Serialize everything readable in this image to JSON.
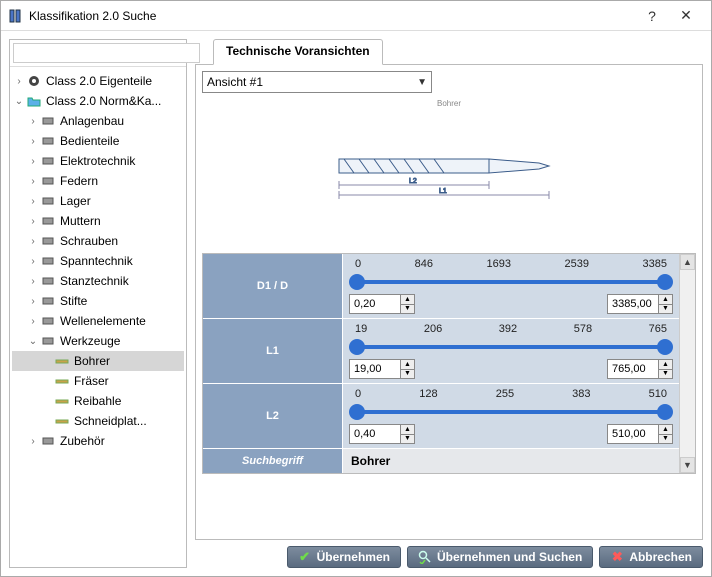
{
  "window": {
    "title": "Klassifikation 2.0 Suche",
    "help": "?",
    "close": "✕"
  },
  "sidebar": {
    "search_placeholder": "",
    "nodes": [
      {
        "level": 1,
        "caret": "right",
        "icon": "gear",
        "label": "Class 2.0 Eigenteile"
      },
      {
        "level": 1,
        "caret": "down",
        "icon": "folder",
        "label": "Class 2.0 Norm&Ka..."
      },
      {
        "level": 2,
        "caret": "right",
        "icon": "part",
        "label": "Anlagenbau"
      },
      {
        "level": 2,
        "caret": "right",
        "icon": "part",
        "label": "Bedienteile"
      },
      {
        "level": 2,
        "caret": "right",
        "icon": "part",
        "label": "Elektrotechnik"
      },
      {
        "level": 2,
        "caret": "right",
        "icon": "part",
        "label": "Federn"
      },
      {
        "level": 2,
        "caret": "right",
        "icon": "part",
        "label": "Lager"
      },
      {
        "level": 2,
        "caret": "right",
        "icon": "part",
        "label": "Muttern"
      },
      {
        "level": 2,
        "caret": "right",
        "icon": "part",
        "label": "Schrauben"
      },
      {
        "level": 2,
        "caret": "right",
        "icon": "part",
        "label": "Spanntechnik"
      },
      {
        "level": 2,
        "caret": "right",
        "icon": "part",
        "label": "Stanztechnik"
      },
      {
        "level": 2,
        "caret": "right",
        "icon": "part",
        "label": "Stifte"
      },
      {
        "level": 2,
        "caret": "right",
        "icon": "part",
        "label": "Wellenelemente"
      },
      {
        "level": 2,
        "caret": "down",
        "icon": "part",
        "label": "Werkzeuge"
      },
      {
        "level": 3,
        "caret": "none",
        "icon": "tool",
        "label": "Bohrer",
        "selected": true
      },
      {
        "level": 3,
        "caret": "none",
        "icon": "tool",
        "label": "Fräser"
      },
      {
        "level": 3,
        "caret": "none",
        "icon": "tool",
        "label": "Reibahle"
      },
      {
        "level": 3,
        "caret": "none",
        "icon": "tool",
        "label": "Schneidplat..."
      },
      {
        "level": 2,
        "caret": "right",
        "icon": "part",
        "label": "Zubehör"
      }
    ]
  },
  "main": {
    "tab_label": "Technische Voransichten",
    "view_selected": "Ansicht #1",
    "preview_label": "Bohrer",
    "preview_dims": {
      "l1": "L1",
      "l2": "L2"
    },
    "params": [
      {
        "name": "D1 / D",
        "ticks": [
          "0",
          "846",
          "1693",
          "2539",
          "3385"
        ],
        "min_value": "0,20",
        "max_value": "3385,00"
      },
      {
        "name": "L1",
        "ticks": [
          "19",
          "206",
          "392",
          "578",
          "765"
        ],
        "min_value": "19,00",
        "max_value": "765,00"
      },
      {
        "name": "L2",
        "ticks": [
          "0",
          "128",
          "255",
          "383",
          "510"
        ],
        "min_value": "0,40",
        "max_value": "510,00"
      }
    ],
    "search_term_label": "Suchbegriff",
    "search_term_value": "Bohrer"
  },
  "buttons": {
    "apply": "Übernehmen",
    "apply_search": "Übernehmen und Suchen",
    "cancel": "Abbrechen"
  }
}
